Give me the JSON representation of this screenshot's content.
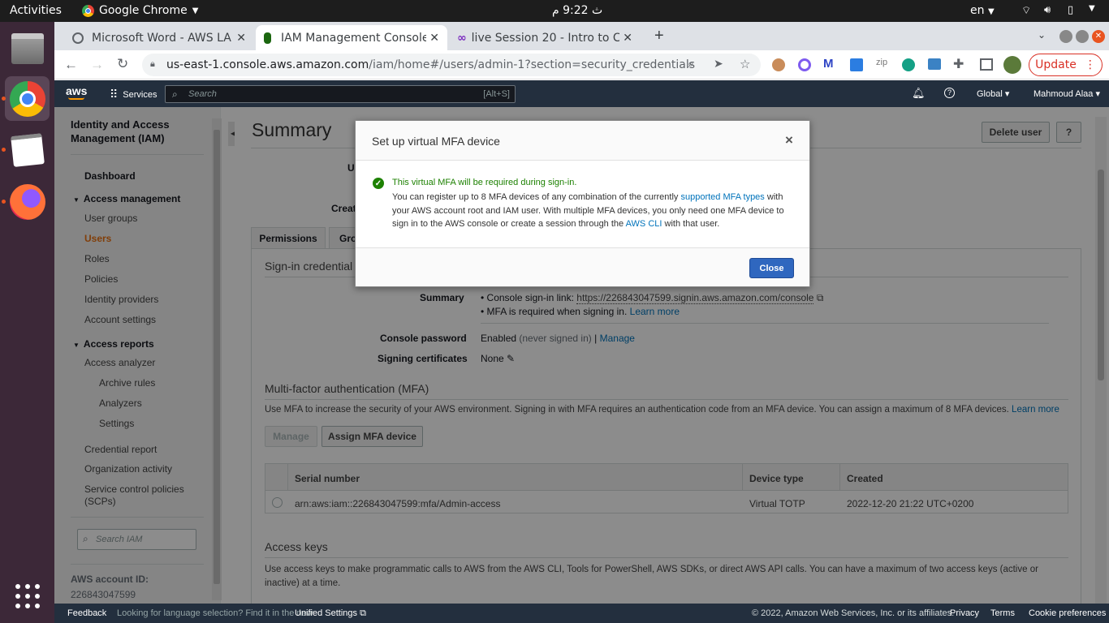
{
  "os": {
    "activities": "Activities",
    "app_menu": "Google Chrome",
    "clock": "ث 9:22 م",
    "lang": "en"
  },
  "browser": {
    "tabs": [
      {
        "title": "Microsoft Word - AWS LA"
      },
      {
        "title": "IAM Management Console"
      },
      {
        "title": "live Session 20 - Intro to C"
      }
    ],
    "url_host": "us-east-1.console.aws.amazon.com",
    "url_path": "/iam/home#/users/admin-1?section=security_credentials",
    "update_label": "Update"
  },
  "aws_nav": {
    "logo": "aws",
    "services": "Services",
    "search_placeholder": "Search",
    "search_shortcut": "[Alt+S]",
    "region": "Global",
    "user": "Mahmoud Alaa"
  },
  "sidebar": {
    "title": "Identity and Access Management (IAM)",
    "dashboard": "Dashboard",
    "access_management": "Access management",
    "items_am": [
      "User groups",
      "Users",
      "Roles",
      "Policies",
      "Identity providers",
      "Account settings"
    ],
    "access_reports": "Access reports",
    "access_analyzer": "Access analyzer",
    "analyzer_sub": [
      "Archive rules",
      "Analyzers",
      "Settings"
    ],
    "items_reports": [
      "Credential report",
      "Organization activity",
      "Service control policies (SCPs)"
    ],
    "search_placeholder": "Search IAM",
    "account_id_label": "AWS account ID:",
    "account_id": "226843047599"
  },
  "main": {
    "title": "Summary",
    "delete_user": "Delete user",
    "help": "?",
    "label_user": "U",
    "label_creat": "Creat",
    "tabs": [
      "Permissions",
      "Gro"
    ],
    "signin_heading": "Sign-in credential",
    "summary_label": "Summary",
    "console_link_prefix": "Console sign-in link: ",
    "console_link": "https://226843047599.signin.aws.amazon.com/console",
    "mfa_required": "MFA is required when signing in.",
    "learn_more": "Learn more",
    "console_password_label": "Console password",
    "console_password_value": "Enabled",
    "never_signed": "(never signed in)",
    "sep": "|",
    "manage": "Manage",
    "signing_certs_label": "Signing certificates",
    "signing_certs_value": "None",
    "mfa_heading": "Multi-factor authentication (MFA)",
    "mfa_desc": "Use MFA to increase the security of your AWS environment. Signing in with MFA requires an authentication code from an MFA device. You can assign a maximum of 8 MFA devices.",
    "mfa_learn_more": "Learn more",
    "manage_btn": "Manage",
    "assign_btn": "Assign MFA device",
    "table_headers": [
      "Serial number",
      "Device type",
      "Created"
    ],
    "table_rows": [
      {
        "serial": "arn:aws:iam::226843047599:mfa/Admin-access",
        "type": "Virtual TOTP",
        "created": "2022-12-20 21:22 UTC+0200"
      }
    ],
    "access_keys_heading": "Access keys",
    "access_keys_desc": "Use access keys to make programmatic calls to AWS from the AWS CLI, Tools for PowerShell, AWS SDKs, or direct AWS API calls. You can have a maximum of two access keys (active or inactive) at a time."
  },
  "modal": {
    "title": "Set up virtual MFA device",
    "close_x": "×",
    "success": "This virtual MFA will be required during sign-in.",
    "body_1": "You can register up to 8 MFA devices of any combination of the currently ",
    "body_link1": "supported MFA types",
    "body_2": " with your AWS account root and IAM user. With multiple MFA devices, you only need one MFA device to sign in to the AWS console or create a session through the ",
    "body_link2": "AWS CLI",
    "body_3": " with that user.",
    "close_btn": "Close"
  },
  "footer": {
    "feedback": "Feedback",
    "language_note": "Looking for language selection? Find it in the new",
    "unified": "Unified Settings",
    "copyright": "© 2022, Amazon Web Services, Inc. or its affiliates.",
    "privacy": "Privacy",
    "terms": "Terms",
    "cookies": "Cookie preferences"
  }
}
